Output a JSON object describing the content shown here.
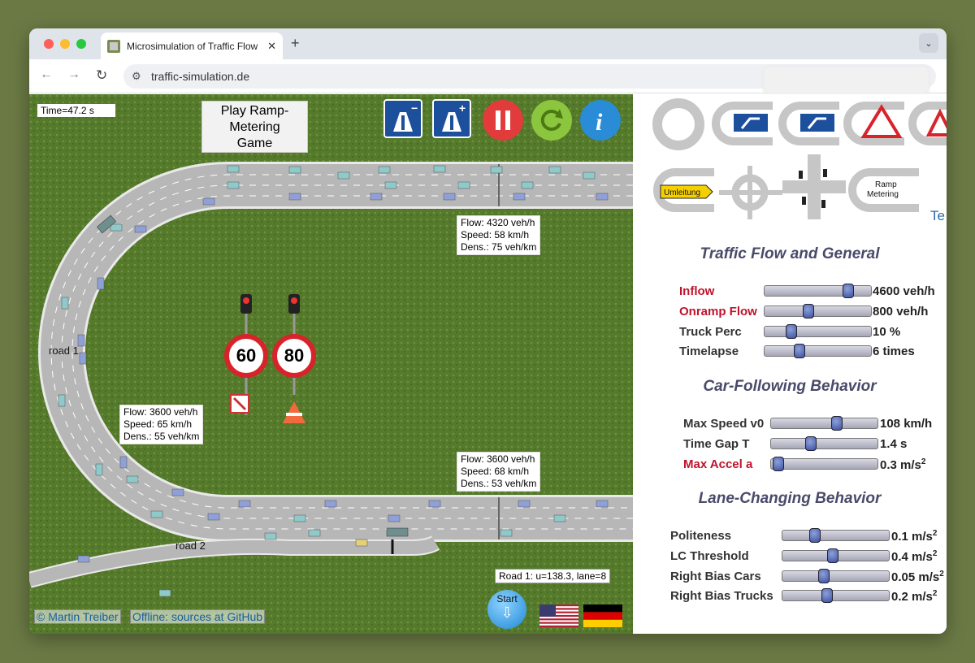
{
  "browser": {
    "tab_title": "Microsimulation of Traffic Flow",
    "url": "traffic-simulation.de"
  },
  "sim": {
    "time": "Time=47.2 s",
    "game_button": [
      "Play Ramp-",
      "Metering",
      "Game"
    ],
    "road1_label": "road 1",
    "road2_label": "road 2",
    "info_top": [
      "Flow: 4320 veh/h",
      "Speed: 58 km/h",
      "Dens.: 75 veh/km"
    ],
    "info_left": [
      "Flow: 3600 veh/h",
      "Speed: 65 km/h",
      "Dens.: 55 veh/km"
    ],
    "info_bottom": [
      "Flow: 3600 veh/h",
      "Speed: 68 km/h",
      "Dens.: 53 veh/km"
    ],
    "speed_sign_1": "60",
    "speed_sign_2": "80",
    "road_info": "Road 1: u=138.3, lane=8",
    "credit_author": "© Martin Treiber",
    "credit_github": "Offline: sources at GitHub",
    "start_label": "Start",
    "icons": [
      "remove-lane-icon",
      "add-lane-icon",
      "pause-icon",
      "restart-icon",
      "info-icon"
    ],
    "colors": {
      "pause": "#e23b3b",
      "restart": "#8cc63f",
      "info": "#2a8bd6",
      "motorway_sign": "#1c4f9c"
    }
  },
  "panel": {
    "thumb_labels": {
      "umleitung": "Umleitung",
      "ramp_metering": "Ramp Metering"
    },
    "te_text": "Te",
    "sections": {
      "traffic": "Traffic Flow and General",
      "carfollowing": "Car-Following Behavior",
      "lanechange": "Lane-Changing Behavior"
    },
    "sliders": {
      "inflow": {
        "label": "Inflow",
        "value": "4600 veh/h",
        "level": 0.82
      },
      "onramp": {
        "label": "Onramp Flow",
        "value": "800 veh/h",
        "level": 0.4
      },
      "truck": {
        "label": "Truck Perc",
        "value": "10 %",
        "level": 0.22
      },
      "timelapse": {
        "label": "Timelapse",
        "value": "6 times",
        "level": 0.31
      },
      "maxspeed": {
        "label": "Max Speed v0",
        "value": "108 km/h",
        "level": 0.63
      },
      "timegap": {
        "label": "Time Gap T",
        "value": "1.4 s",
        "level": 0.36
      },
      "maxaccel": {
        "label": "Max Accel a",
        "value": "0.3 m/s",
        "level": 0.02
      },
      "politeness": {
        "label": "Politeness",
        "value": "0.1 m/s",
        "level": 0.28
      },
      "lcthreshold": {
        "label": "LC Threshold",
        "value": "0.4 m/s",
        "level": 0.47
      },
      "biascars": {
        "label": "Right Bias Cars",
        "value": "0.05 m/s",
        "level": 0.38
      },
      "biastrucks": {
        "label": "Right Bias Trucks",
        "value": "0.2 m/s",
        "level": 0.41
      }
    }
  }
}
